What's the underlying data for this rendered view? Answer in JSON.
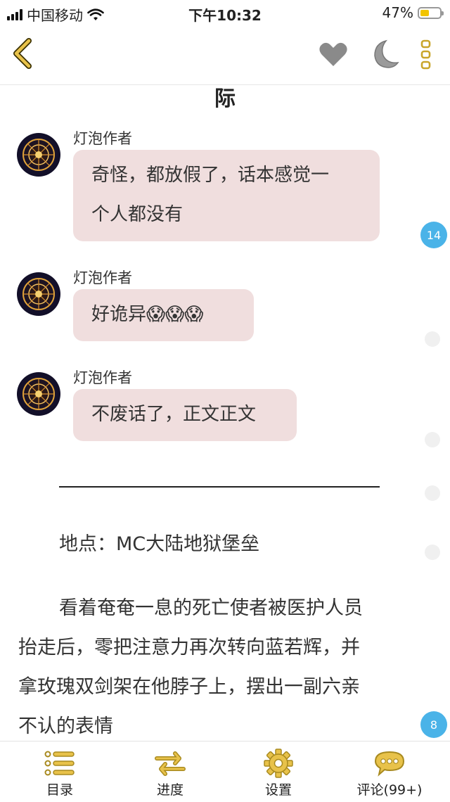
{
  "status_bar": {
    "carrier": "中国移动",
    "time": "下午10:32",
    "battery_percent": "47%",
    "battery_level": 0.47
  },
  "nav": {
    "icons": [
      "back-chevron-icon",
      "heart-icon",
      "moon-icon",
      "more-dots-icon"
    ],
    "accent_color": "#e8c24a"
  },
  "chapter": {
    "partial_title": "际"
  },
  "messages": [
    {
      "author": "灯泡作者",
      "lines": [
        "奇怪，都放假了，话本感觉一",
        "个人都没有"
      ]
    },
    {
      "author": "灯泡作者",
      "lines": [
        "好诡异😱😱😱"
      ]
    },
    {
      "author": "灯泡作者",
      "lines": [
        "不废话了，正文正文"
      ]
    }
  ],
  "comment_counts": {
    "msg1": "14",
    "para": "8"
  },
  "body": {
    "location": "地点：MC大陆地狱堡垒",
    "paragraph_lines": [
      "看着奄奄一息的死亡使者被医护人员",
      "抬走后，零把注意力再次转向蓝若辉，并",
      "拿玫瑰双剑架在他脖子上，摆出一副六亲",
      "不认的表情"
    ]
  },
  "tabs": [
    {
      "label": "目录",
      "icon": "list-icon"
    },
    {
      "label": "进度",
      "icon": "swap-arrows-icon"
    },
    {
      "label": "设置",
      "icon": "gear-icon"
    },
    {
      "label": "评论(99+)",
      "icon": "comment-bubble-icon"
    }
  ],
  "colors": {
    "bubble": "#f0dede",
    "badge": "#4ab3e8",
    "icon_yellow": "#e8c24a",
    "icon_gray": "#8a8a8a"
  }
}
